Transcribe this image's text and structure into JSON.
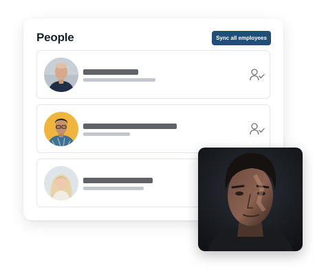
{
  "people_card": {
    "title": "People",
    "sync_button_label": "Sync all employees"
  },
  "employees": [
    {
      "avatar": "bald-man-avatar",
      "status_icon": "user-check-icon",
      "name_placeholder": "redacted-name-bar",
      "subtitle_placeholder": "redacted-subtitle-bar"
    },
    {
      "avatar": "man-with-glasses-avatar",
      "status_icon": "user-check-icon",
      "name_placeholder": "redacted-name-bar",
      "subtitle_placeholder": "redacted-subtitle-bar"
    },
    {
      "avatar": "blonde-woman-avatar",
      "status_icon": null,
      "name_placeholder": "redacted-name-bar",
      "subtitle_placeholder": "redacted-subtitle-bar"
    }
  ],
  "overlay_photo": {
    "subject": "man-portrait-photo"
  },
  "colors": {
    "primary_button": "#1f4e79",
    "placeholder_dark": "#5f6368",
    "placeholder_light": "#c3c6ca",
    "row_border": "#e3e6ea"
  }
}
